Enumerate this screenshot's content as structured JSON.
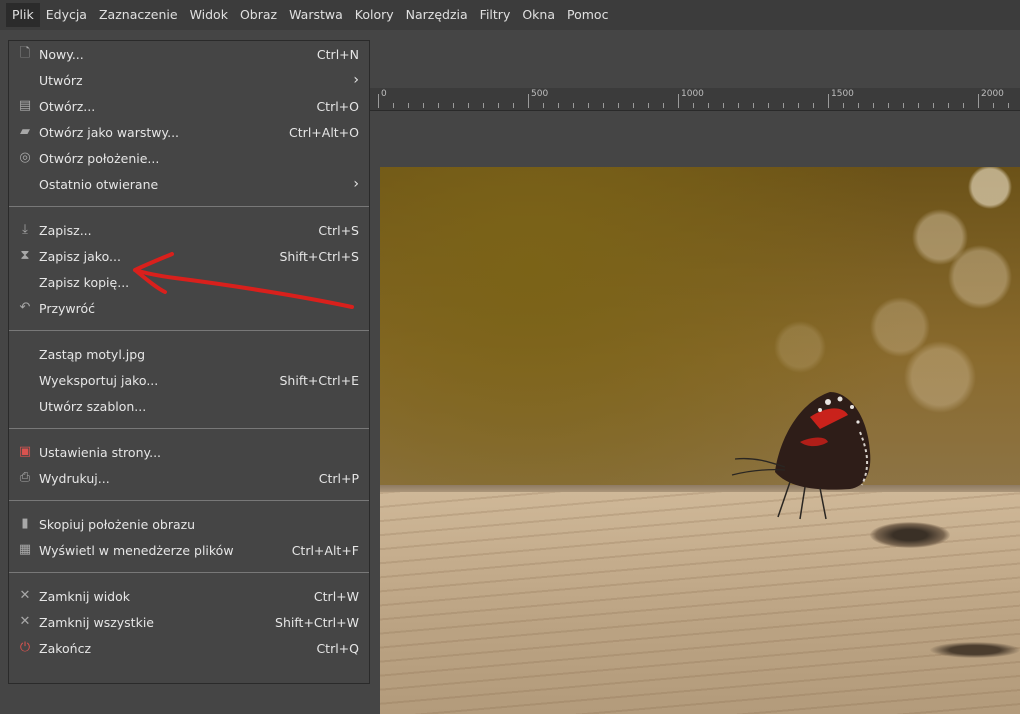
{
  "menubar": {
    "items": [
      "Plik",
      "Edycja",
      "Zaznaczenie",
      "Widok",
      "Obraz",
      "Warstwa",
      "Kolory",
      "Narzędzia",
      "Filtry",
      "Okna",
      "Pomoc"
    ]
  },
  "ruler": {
    "labels": [
      "0",
      "500",
      "1000",
      "1500",
      "2000"
    ]
  },
  "file_menu": {
    "groups": [
      [
        {
          "label": "Nowy...",
          "shortcut": "Ctrl+N",
          "icon": "new-document-icon"
        },
        {
          "label": "Utwórz",
          "submenu": true
        },
        {
          "label": "Otwórz...",
          "shortcut": "Ctrl+O",
          "icon": "open-icon"
        },
        {
          "label": "Otwórz jako warstwy...",
          "shortcut": "Ctrl+Alt+O",
          "icon": "open-as-layers-icon"
        },
        {
          "label": "Otwórz położenie...",
          "icon": "open-location-icon"
        },
        {
          "label": "Ostatnio otwierane",
          "submenu": true
        }
      ],
      [
        {
          "label": "Zapisz...",
          "shortcut": "Ctrl+S",
          "icon": "save-icon"
        },
        {
          "label": "Zapisz jako...",
          "shortcut": "Shift+Ctrl+S",
          "icon": "save-as-icon"
        },
        {
          "label": "Zapisz kopię..."
        },
        {
          "label": "Przywróć",
          "icon": "revert-icon"
        }
      ],
      [
        {
          "label": "Zastąp motyl.jpg"
        },
        {
          "label": "Wyeksportuj jako...",
          "shortcut": "Shift+Ctrl+E"
        },
        {
          "label": "Utwórz szablon..."
        }
      ],
      [
        {
          "label": "Ustawienia strony...",
          "icon": "page-setup-icon"
        },
        {
          "label": "Wydrukuj...",
          "shortcut": "Ctrl+P",
          "icon": "print-icon"
        }
      ],
      [
        {
          "label": "Skopiuj położenie obrazu",
          "icon": "copy-location-icon"
        },
        {
          "label": "Wyświetl w menedżerze plików",
          "shortcut": "Ctrl+Alt+F",
          "icon": "file-manager-icon"
        }
      ],
      [
        {
          "label": "Zamknij widok",
          "shortcut": "Ctrl+W",
          "icon": "close-icon"
        },
        {
          "label": "Zamknij wszystkie",
          "shortcut": "Shift+Ctrl+W",
          "icon": "close-all-icon"
        },
        {
          "label": "Zakończ",
          "shortcut": "Ctrl+Q",
          "icon": "quit-icon"
        }
      ]
    ]
  },
  "colors": {
    "annotation": "#d9201c",
    "menu_bg": "#454545",
    "menubar_bg": "#3c3c3c"
  }
}
